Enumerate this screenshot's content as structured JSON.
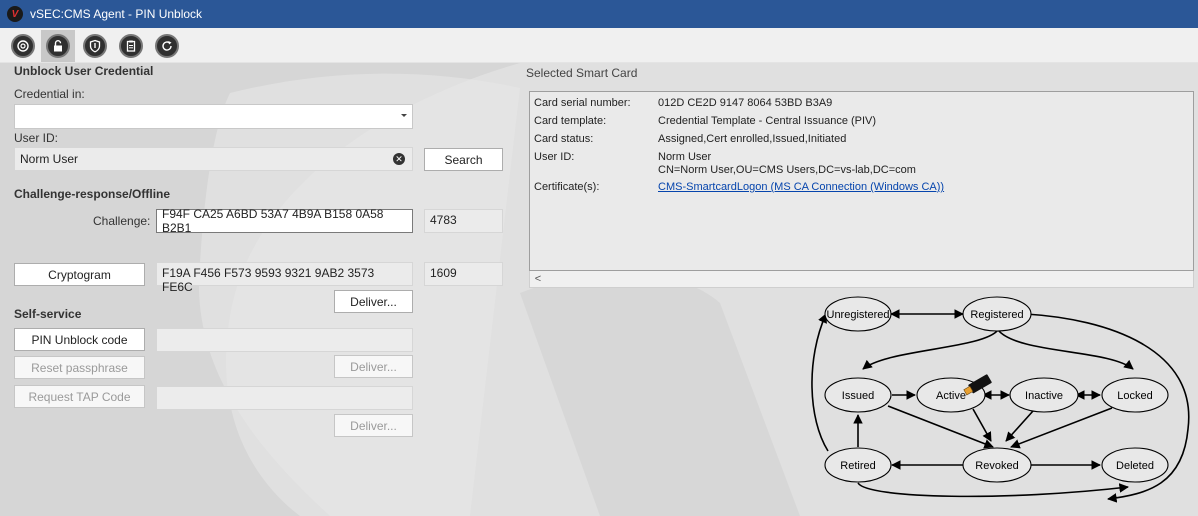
{
  "window": {
    "title": "vSEC:CMS Agent - PIN Unblock",
    "logo_letter": "V"
  },
  "toolbar": {
    "buttons": [
      {
        "icon": "disc-icon"
      },
      {
        "icon": "unlock-icon",
        "active": true
      },
      {
        "icon": "shield-icon"
      },
      {
        "icon": "clipboard-icon"
      },
      {
        "icon": "refresh-icon"
      }
    ]
  },
  "left": {
    "heading": "Unblock User Credential",
    "credential_in_label": "Credential in:",
    "credential_in_value": "",
    "user_id_label": "User ID:",
    "user_id_value": "Norm User",
    "search_label": "Search",
    "challenge_heading": "Challenge-response/Offline",
    "challenge_label": "Challenge:",
    "challenge_value": "F94F CA25 A6BD 53A7 4B9A B158 0A58 B2B1",
    "challenge_code": "4783",
    "cryptogram_label": "Cryptogram",
    "cryptogram_value": "F19A F456 F573 9593 9321 9AB2 3573 FE6C",
    "cryptogram_code": "1609",
    "deliver_label": "Deliver...",
    "self_service_heading": "Self-service",
    "pin_unblock_label": "PIN Unblock code",
    "reset_passphrase_label": "Reset passphrase",
    "request_tap_label": "Request TAP Code"
  },
  "right": {
    "title": "Selected Smart Card",
    "rows": [
      {
        "label": "Card serial number:",
        "value": "012D CE2D 9147 8064 53BD B3A9"
      },
      {
        "label": "Card template:",
        "value": "Credential Template - Central Issuance (PIV)"
      },
      {
        "label": "Card status:",
        "value": "Assigned,Cert enrolled,Issued,Initiated"
      },
      {
        "label": "User ID:",
        "value": "Norm User",
        "value2": "CN=Norm User,OU=CMS Users,DC=vs-lab,DC=com"
      },
      {
        "label": "Certificate(s):",
        "value": "CMS-SmartcardLogon (MS CA Connection (Windows CA))"
      }
    ],
    "scroll_left": "<"
  },
  "lifecycle": {
    "states": {
      "unregistered": "Unregistered",
      "registered": "Registered",
      "issued": "Issued",
      "active": "Active",
      "inactive": "Inactive",
      "locked": "Locked",
      "retired": "Retired",
      "revoked": "Revoked",
      "deleted": "Deleted"
    }
  },
  "colors": {
    "titlebar": "#2b5797",
    "link": "#0645ad",
    "toolbar_icon": "#303030"
  }
}
